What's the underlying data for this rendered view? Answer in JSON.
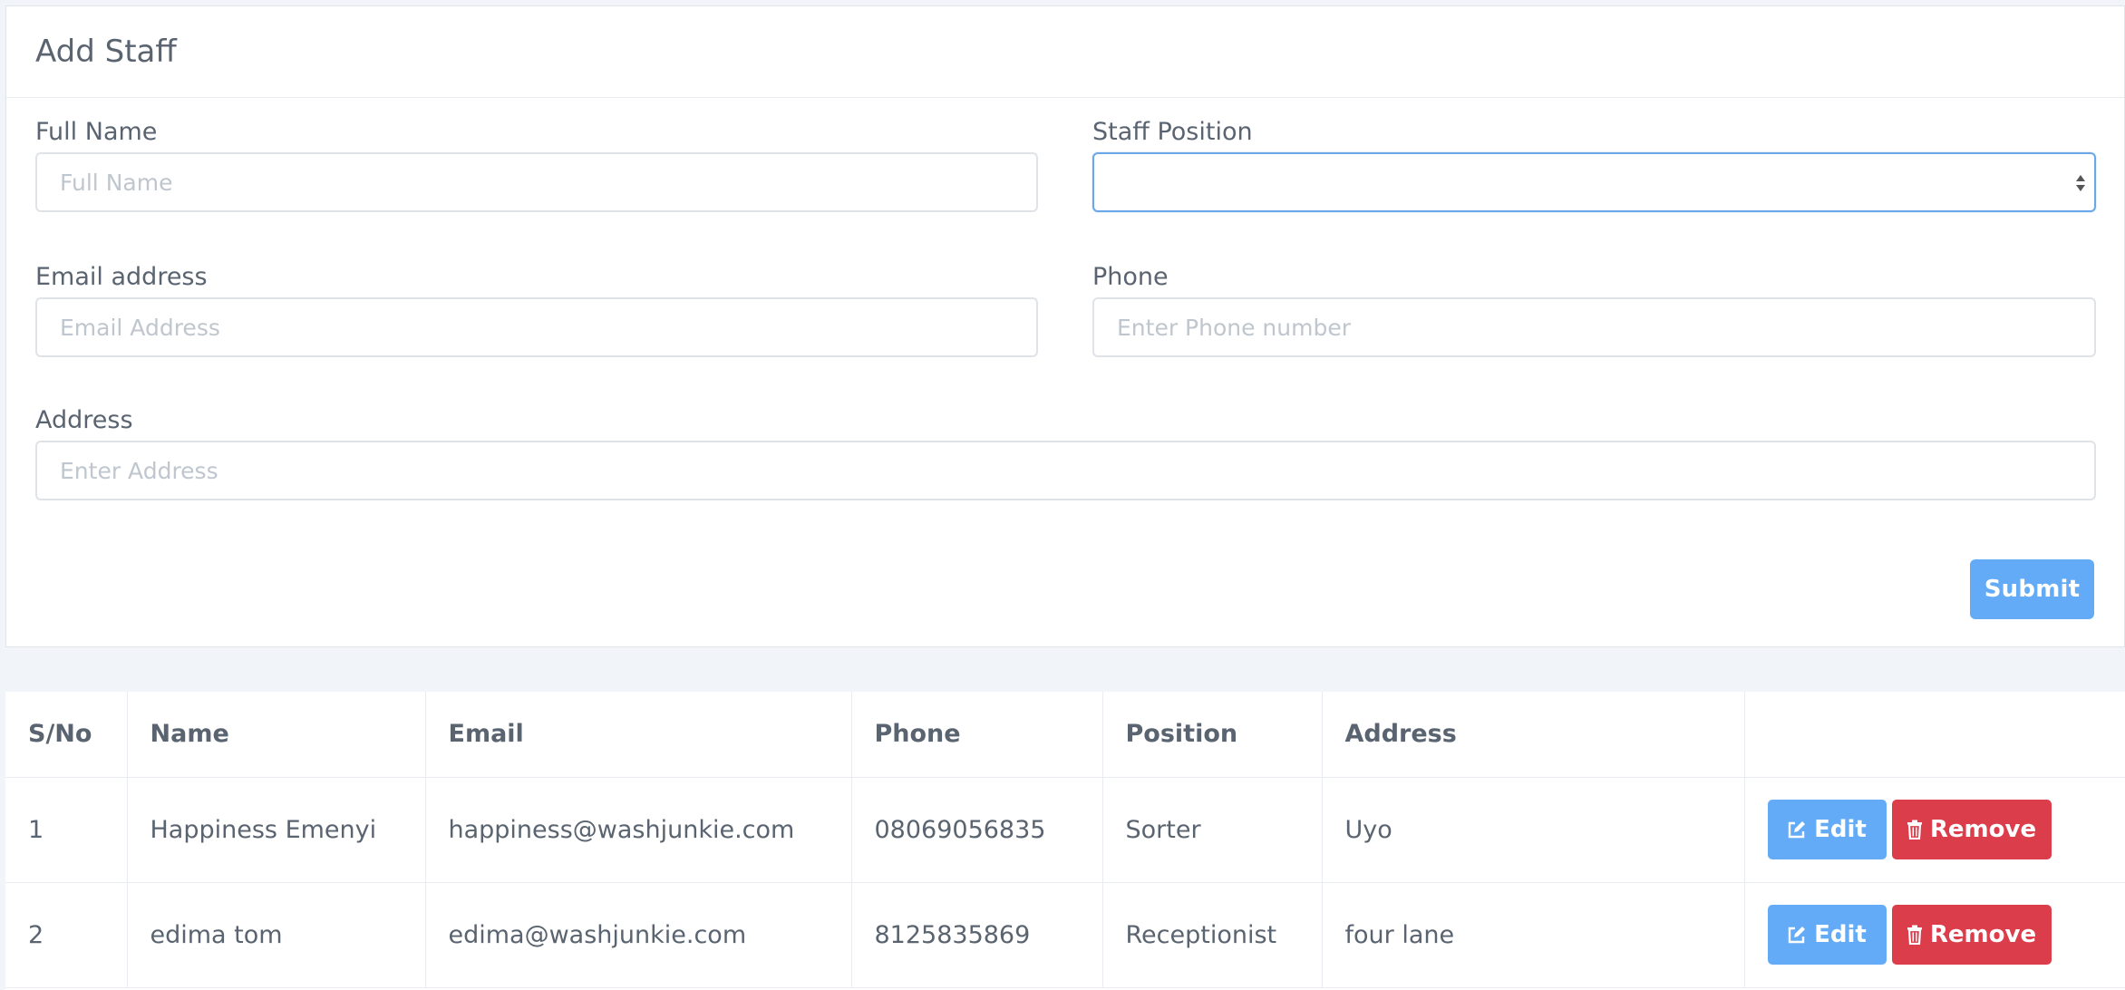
{
  "form": {
    "title": "Add Staff",
    "full_name": {
      "label": "Full Name",
      "placeholder": "Full Name",
      "value": ""
    },
    "staff_position": {
      "label": "Staff Position",
      "selected": ""
    },
    "email": {
      "label": "Email address",
      "placeholder": "Email Address",
      "value": ""
    },
    "phone": {
      "label": "Phone",
      "placeholder": "Enter Phone number",
      "value": ""
    },
    "address": {
      "label": "Address",
      "placeholder": "Enter Address",
      "value": ""
    },
    "submit_label": "Submit"
  },
  "table": {
    "headers": [
      "S/No",
      "Name",
      "Email",
      "Phone",
      "Position",
      "Address",
      ""
    ],
    "rows": [
      {
        "sno": "1",
        "name": "Happiness Emenyi",
        "email": "happiness@washjunkie.com",
        "phone": "08069056835",
        "position": "Sorter",
        "address": "Uyo"
      },
      {
        "sno": "2",
        "name": "edima tom",
        "email": "edima@washjunkie.com",
        "phone": "8125835869",
        "position": "Receptionist",
        "address": "four lane"
      }
    ],
    "edit_label": "Edit",
    "remove_label": "Remove"
  },
  "icons": {
    "edit": "edit-square-icon",
    "remove": "trash-icon",
    "select_caret": "updown-caret-icon"
  },
  "colors": {
    "primary": "#64abf7",
    "danger": "#dc3d4b",
    "focus_border": "#6aa6e8"
  }
}
